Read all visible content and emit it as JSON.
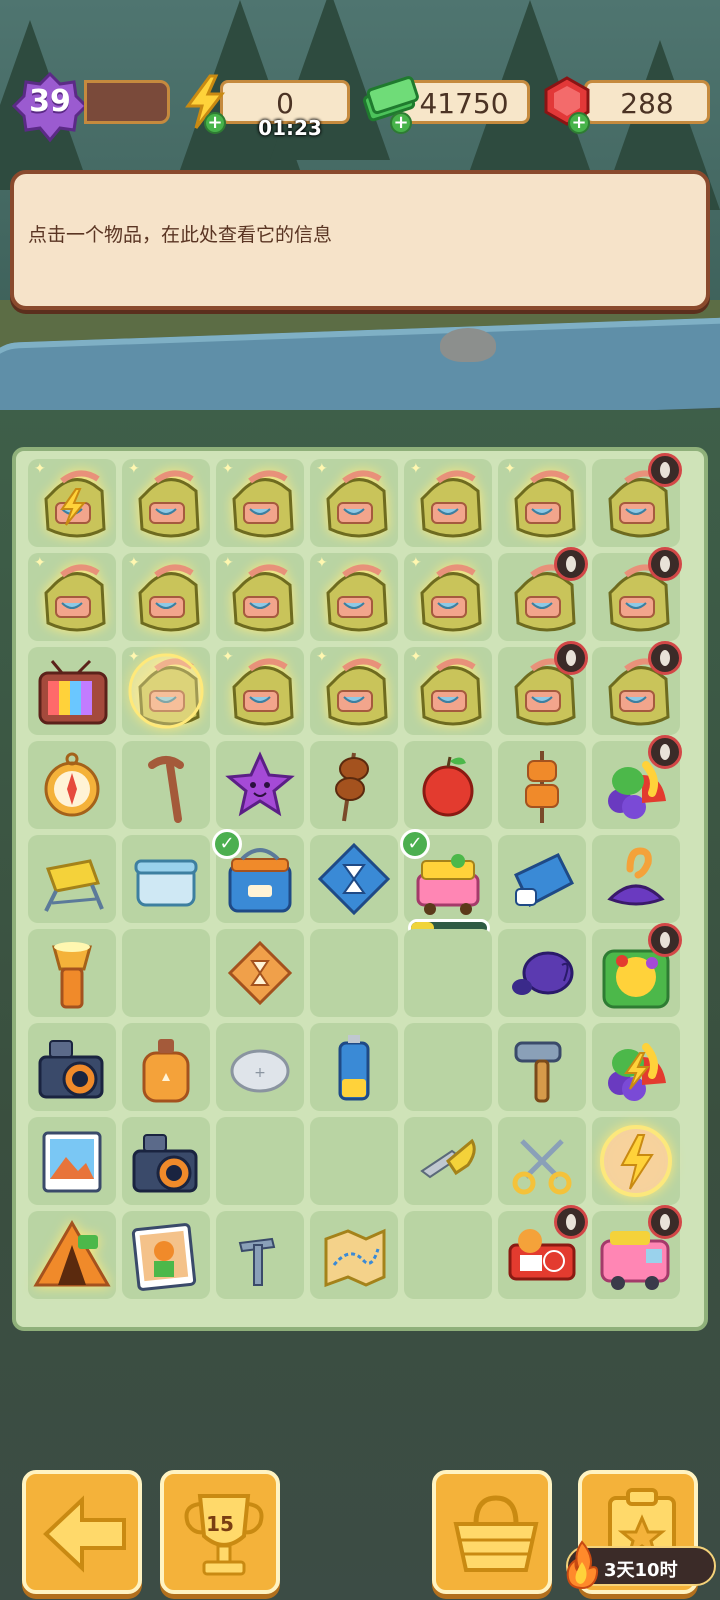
{
  "hud": {
    "level": "39",
    "energy": "0",
    "energy_timer": "01:23",
    "cash": "41750",
    "gems": "288"
  },
  "info_panel": {
    "hint": "点击一个物品，在此处查看它的信息"
  },
  "board": {
    "rows": [
      [
        "backpack-energy",
        "backpack",
        "backpack",
        "backpack",
        "backpack",
        "backpack",
        "backpack-locked"
      ],
      [
        "backpack",
        "backpack",
        "backpack",
        "backpack",
        "backpack",
        "backpack-locked",
        "backpack-locked"
      ],
      [
        "tv-generator",
        "backpack-bubble",
        "backpack",
        "backpack",
        "backpack",
        "backpack-locked",
        "backpack-locked"
      ],
      [
        "compass",
        "walking-cane",
        "purple-star-creature",
        "grilled-skewer",
        "red-apple",
        "corn-skewer",
        "fruit-basket-locked"
      ],
      [
        "folding-stool",
        "lunch-box",
        "cooler-box-ready",
        "blue-hourglass-booster",
        "picnic-cart-generator",
        "blue-cooler-bag",
        "mystery-hat"
      ],
      [
        "flashlight",
        "",
        "orange-hourglass-booster",
        "",
        "",
        "purple-beetle",
        "fruit-platter-locked"
      ],
      [
        "camera",
        "orange-canteen",
        "coin-battery",
        "aa-battery",
        "",
        "hammer",
        "fruit-basket-energy"
      ],
      [
        "photo-print",
        "camera",
        "",
        "",
        "pocket-knife",
        "scissors",
        "energy-bubble"
      ],
      [
        "camping-tent-generator",
        "photo-album",
        "tent-peg",
        "treasure-map",
        "",
        "picnic-table-locked",
        "camper-van-locked"
      ]
    ],
    "picnic_cart_progress": 0.3
  },
  "bottom_bar": {
    "trophy_count": "15",
    "event_timer": "3天10时"
  },
  "colors": {
    "board_bg": "#cfe3b8",
    "cell_bg": "#b9d4a3",
    "button_orange": "#f4b23a",
    "panel_bg": "#f6e3c9"
  }
}
